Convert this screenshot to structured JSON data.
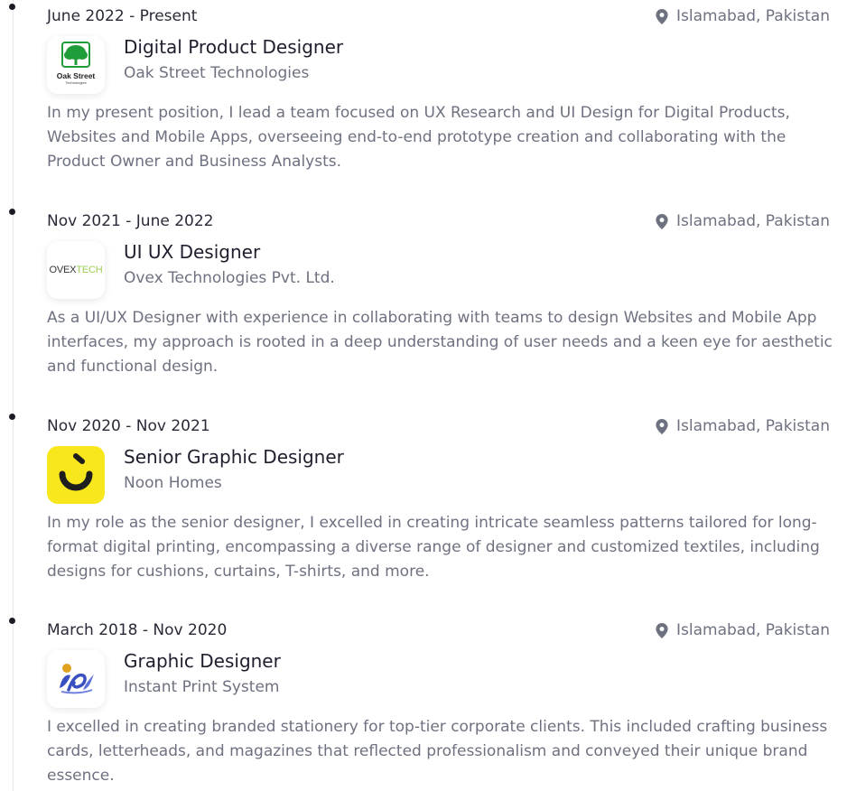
{
  "experience": [
    {
      "date": "June 2022 - Present",
      "location": "Islamabad, Pakistan",
      "title": "Digital Product Designer",
      "company": "Oak Street Technologies",
      "logo_text": "Oak Street",
      "logo_subtext": "Technologies",
      "description": "In my present position, I lead a team focused on UX Research and UI Design for Digital Products, Websites and Mobile Apps, overseeing end-to-end prototype creation and collaborating with the Product Owner and Business Analysts."
    },
    {
      "date": "Nov 2021 - June 2022",
      "location": "Islamabad, Pakistan",
      "title": "UI UX Designer",
      "company": "Ovex Technologies Pvt. Ltd.",
      "logo_text_a": "OVEX",
      "logo_text_b": "TECH",
      "description": "As a UI/UX Designer with experience in collaborating with teams to design Websites and Mobile App interfaces, my approach is rooted in a deep understanding of user needs and a keen eye for aesthetic and functional design."
    },
    {
      "date": "Nov 2020 - Nov 2021",
      "location": "Islamabad, Pakistan",
      "title": "Senior Graphic Designer",
      "company": "Noon Homes",
      "description": "In my role as the senior designer, I excelled in creating intricate seamless patterns tailored for long-format digital printing, encompassing a diverse range of designer and customized textiles, including designs for cushions, curtains, T-shirts, and more."
    },
    {
      "date": "March 2018 - Nov 2020",
      "location": "Islamabad, Pakistan",
      "title": "Graphic Designer",
      "company": "Instant Print System",
      "description": "I excelled in creating branded stationery for top-tier corporate clients. This included crafting business cards, letterheads, and magazines that reflected professionalism and conveyed their unique brand essence."
    }
  ],
  "icons": {
    "location": "map-pin-icon"
  },
  "colors": {
    "oak_green": "#1f9d3a",
    "noon_yellow": "#f8e71c",
    "ovex_green": "#9ccc52",
    "muted_text": "#6e7180"
  }
}
